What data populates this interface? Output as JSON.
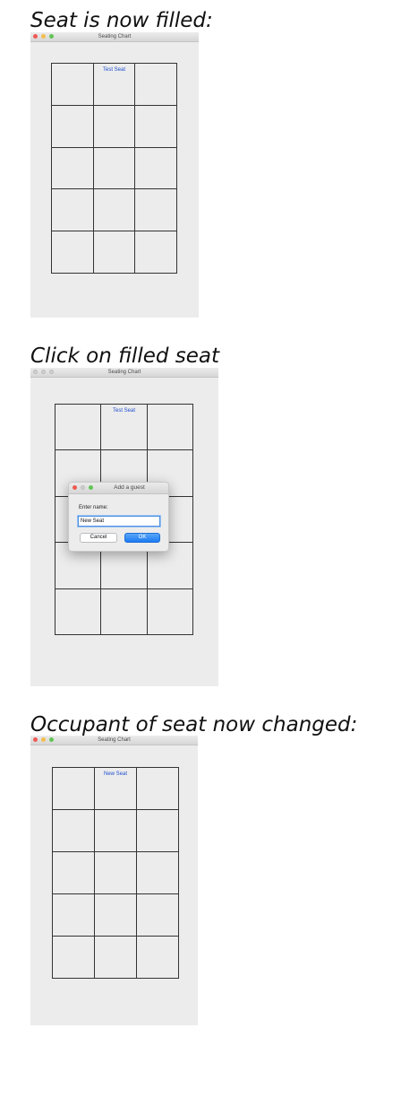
{
  "panels": [
    {
      "caption": "Seat is now filled:",
      "window_title": "Seating Chart",
      "seats": [
        "",
        "Test Seat",
        "",
        "",
        "",
        "",
        "",
        "",
        "",
        "",
        "",
        "",
        "",
        "",
        ""
      ]
    },
    {
      "caption": "Click on filled seat",
      "window_title": "Seating Chart",
      "seats": [
        "",
        "Test Seat",
        "",
        "",
        "",
        "",
        "",
        "",
        "",
        "",
        "",
        "",
        "",
        "",
        ""
      ],
      "dialog": {
        "title": "Add a guest",
        "prompt": "Enter name:",
        "input_value": "New Seat",
        "cancel_label": "Cancel",
        "ok_label": "OK"
      }
    },
    {
      "caption": "Occupant of seat now changed:",
      "window_title": "Seating Chart",
      "seats": [
        "",
        "New Seat",
        "",
        "",
        "",
        "",
        "",
        "",
        "",
        "",
        "",
        "",
        "",
        "",
        ""
      ]
    }
  ],
  "colors": {
    "window_bg": "#ececec",
    "seat_text": "#1f4fcf",
    "ok_button": "#1c7bf1",
    "traffic_red": "#ee5a52",
    "traffic_yellow": "#f5bd4f",
    "traffic_green": "#61c454"
  }
}
